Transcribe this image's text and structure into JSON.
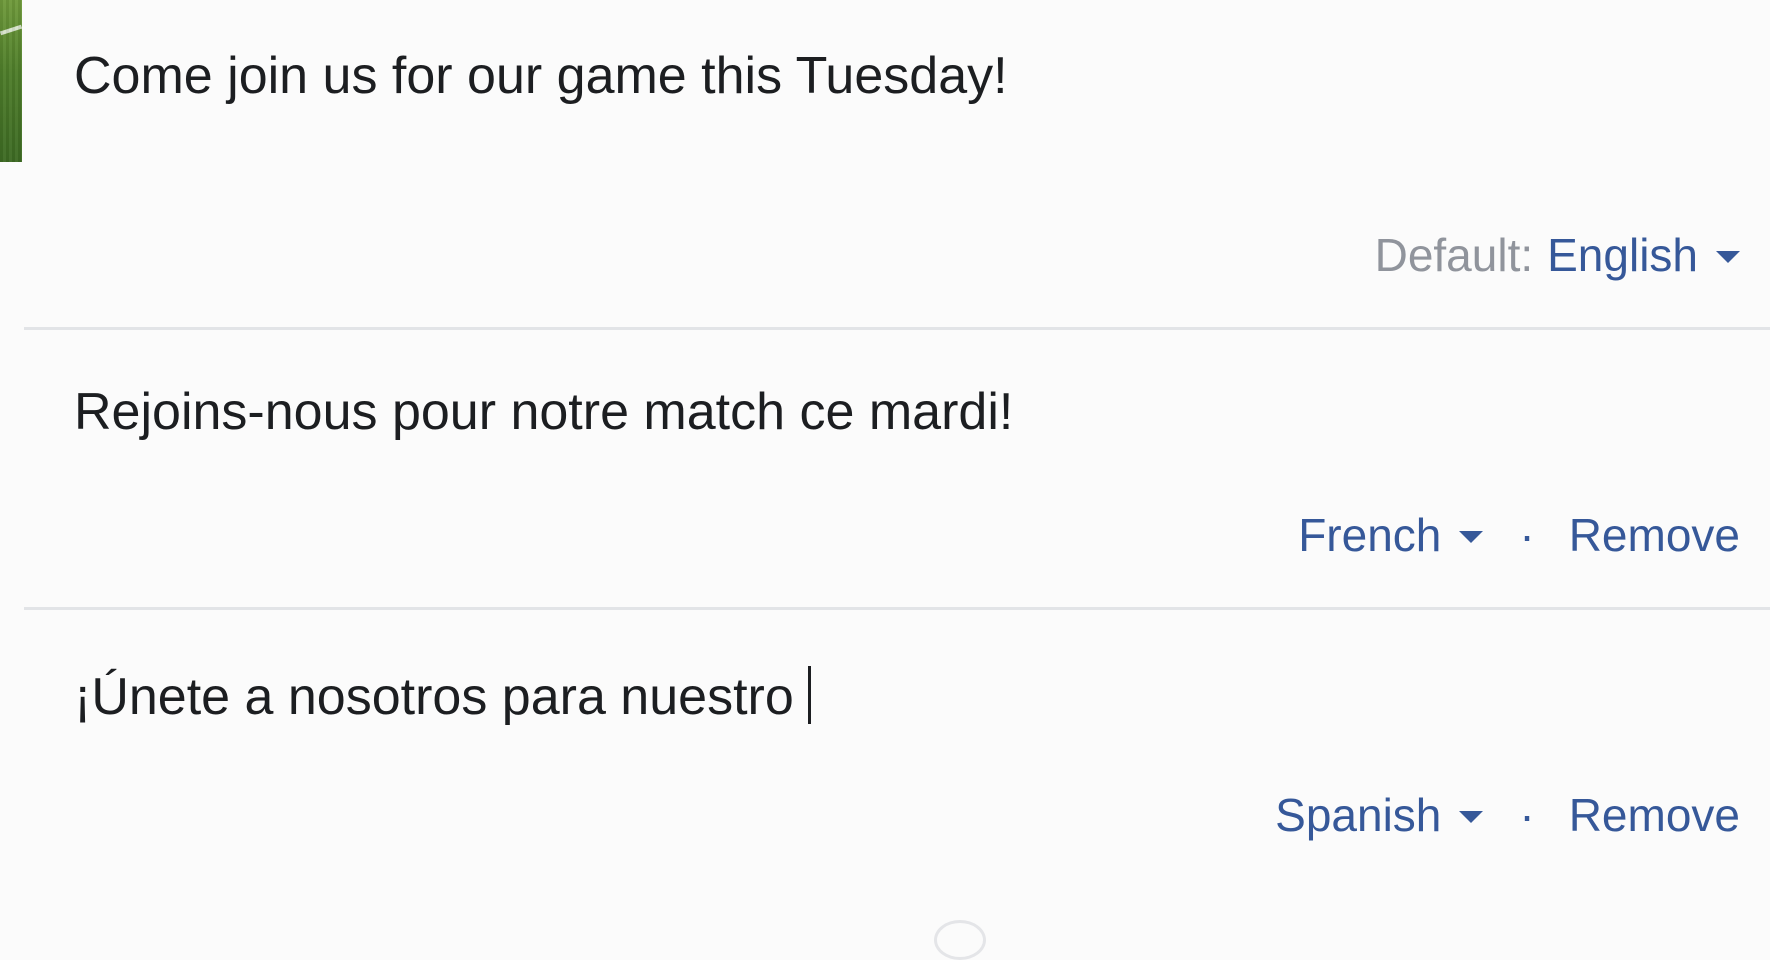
{
  "entries": [
    {
      "text": "Come join us for our game this Tuesday!",
      "label": "Default:",
      "language": "English",
      "remove": ""
    },
    {
      "text": "Rejoins-nous pour notre match ce mardi!",
      "label": "",
      "language": "French",
      "separator": "·",
      "remove": "Remove"
    },
    {
      "text": "¡Únete a nosotros para nuestro",
      "label": "",
      "language": "Spanish",
      "separator": "·",
      "remove": "Remove"
    }
  ],
  "icons": {
    "language_dropdown": "chevron-down-icon"
  },
  "colors": {
    "link": "#365899",
    "muted": "#90949c",
    "text": "#1c1e21",
    "divider": "#e2e4e7",
    "background": "#fbfbfb"
  }
}
